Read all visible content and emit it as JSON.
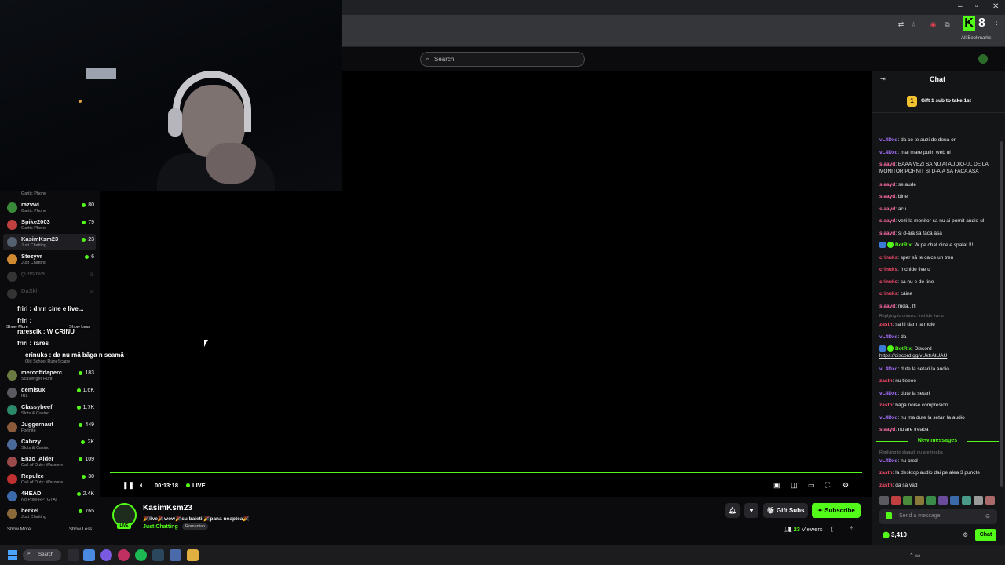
{
  "browser": {
    "bookmarks_label": "All Bookmarks",
    "extension_badge": "8",
    "extension_letter": "K"
  },
  "header": {
    "search_placeholder": "Search"
  },
  "sidebar": {
    "top_partial_category": "Gartic Phone",
    "channels": [
      {
        "name": "razvwi",
        "category": "Gartic Phone",
        "viewers": "80",
        "color": "#3a8a3a"
      },
      {
        "name": "Spike2003",
        "category": "Gartic Phone",
        "viewers": "79",
        "color": "#c04040"
      },
      {
        "name": "KasimKsm23",
        "category": "Just Chatting",
        "viewers": "23",
        "color": "#556070"
      },
      {
        "name": "Stezyvr",
        "category": "Just Chatting",
        "viewers": "6",
        "color": "#d08a30"
      },
      {
        "name": "gunsowa",
        "category": "",
        "viewers": "",
        "color": "#333333"
      },
      {
        "name": "DaSkh",
        "category": "",
        "viewers": "",
        "color": "#333333"
      },
      {
        "name": "mercoffdaperc",
        "category": "Scavenger Hunt",
        "viewers": "183",
        "color": "#6a7a40"
      },
      {
        "name": "demisux",
        "category": "IRL",
        "viewers": "1.6K",
        "color": "#5a5a60"
      },
      {
        "name": "Classybeef",
        "category": "Slots & Casino",
        "viewers": "1.7K",
        "color": "#2a8a6a"
      },
      {
        "name": "Juggernaut",
        "category": "Fortnite",
        "viewers": "449",
        "color": "#8a5a3a"
      },
      {
        "name": "Cabrzy",
        "category": "Slots & Casino",
        "viewers": "2K",
        "color": "#4a6a9a"
      },
      {
        "name": "Enzo_Alder",
        "category": "Call of Duty: Warzone",
        "viewers": "109",
        "color": "#9a4a4a"
      },
      {
        "name": "Repulze",
        "category": "Call of Duty: Warzone",
        "viewers": "30",
        "color": "#c03030"
      },
      {
        "name": "4HEAD",
        "category": "No Pixel RP (GTA)",
        "viewers": "2.4K",
        "color": "#3a6aaa"
      },
      {
        "name": "berkel",
        "category": "Just Chatting",
        "viewers": "765",
        "color": "#8a6a3a"
      }
    ],
    "partial_category_osrs": "Old School RuneScape",
    "show_more": "Show More",
    "show_less": "Show Less"
  },
  "overlay_chat": [
    {
      "text": "friri : dmn cine e live..."
    },
    {
      "text": "friri :"
    },
    {
      "text": "Show More"
    },
    {
      "text": "Show Less"
    },
    {
      "text": "rarescik : W CRINU"
    },
    {
      "text": "friri : rares"
    },
    {
      "text": "crinuks : da nu mă băga n seamă"
    }
  ],
  "player": {
    "time": "00:13:18",
    "live_label": "LIVE",
    "progress": 1.0
  },
  "stream": {
    "streamer": "KasimKsm23",
    "title": "🎉live🎉wow🎉cu baietii🎉pana noaptea🎉",
    "category": "Just Chatting",
    "tag": "Romanian",
    "live_badge": "LIVE",
    "gift_subs": "Gift Subs",
    "subscribe": "Subscribe",
    "viewers_count": "23",
    "viewers_label": "Viewers"
  },
  "chat": {
    "title": "Chat",
    "gift_rank": "1",
    "gift_text": "Gift 1 sub to take 1st",
    "messages": [
      {
        "user": "vL4Dxd",
        "color": "purple",
        "text": "da ce te auzi de doua ori"
      },
      {
        "user": "vL4Dxd",
        "color": "purple",
        "text": "mai mare putin web ul"
      },
      {
        "user": "slaayd",
        "color": "pink",
        "text": "BAAA VEZI SA NU AI AUDIO-UL DE LA MONITOR PORNIT SI D-AIA SA FACA ASA"
      },
      {
        "user": "slaayd",
        "color": "pink",
        "text": "se aude"
      },
      {
        "user": "slaayd",
        "color": "pink",
        "text": "bine"
      },
      {
        "user": "slaayd",
        "color": "pink",
        "text": "acu"
      },
      {
        "user": "slaayd",
        "color": "pink",
        "text": "vezi la monitor sa nu ai pornit audio-ul"
      },
      {
        "user": "slaayd",
        "color": "pink",
        "text": "si d-aia sa faca asa"
      },
      {
        "user": "BotRix",
        "color": "green",
        "text": "W pe chat cine e spalat !!!"
      },
      {
        "user": "crinuks",
        "color": "red",
        "text": "sper să te calce un tren"
      },
      {
        "user": "crinuks",
        "color": "red",
        "text": "închide live u"
      },
      {
        "user": "crinuks",
        "color": "red",
        "text": "ca nu e de tine"
      },
      {
        "user": "crinuks",
        "color": "red",
        "text": "câine"
      },
      {
        "user": "slaayd",
        "color": "pink",
        "text": "mda.. lfl"
      },
      {
        "user": "zastn",
        "color": "red",
        "text": "sa iti dam la muie"
      },
      {
        "user": "vL4Dxd",
        "color": "purple",
        "text": "da"
      },
      {
        "user": "BotRix",
        "color": "green",
        "text": "Discord"
      },
      {
        "user": "vL4Dxd",
        "color": "purple",
        "text": "dute la setari la audio"
      },
      {
        "user": "zastn",
        "color": "red",
        "text": "nu tieeee"
      },
      {
        "user": "vL4Dxd",
        "color": "purple",
        "text": "dute la setari"
      },
      {
        "user": "zastn",
        "color": "red",
        "text": "baga noise compresion"
      },
      {
        "user": "vL4Dxd",
        "color": "purple",
        "text": "nu ma dute la setari la audio"
      },
      {
        "user": "slaayd",
        "color": "pink",
        "text": "nu are treaba"
      },
      {
        "user": "vL4Dxd",
        "color": "purple",
        "text": "nu cred"
      },
      {
        "user": "zastn",
        "color": "red",
        "text": "la desktop audio dai pe alea 3 puncte"
      },
      {
        "user": "zastn",
        "color": "red",
        "text": "da sa vad"
      }
    ],
    "reply1": "Replying to crinuks: închide live u",
    "reply2": "Replying to slaayd: nu are treaba",
    "discord_link": "https://discord.gg/vUktrAtUAU",
    "new_messages": "New messages",
    "input_placeholder": "Send a message",
    "points": "3,410",
    "send_label": "Chat"
  },
  "taskbar": {
    "search_label": "Search"
  }
}
